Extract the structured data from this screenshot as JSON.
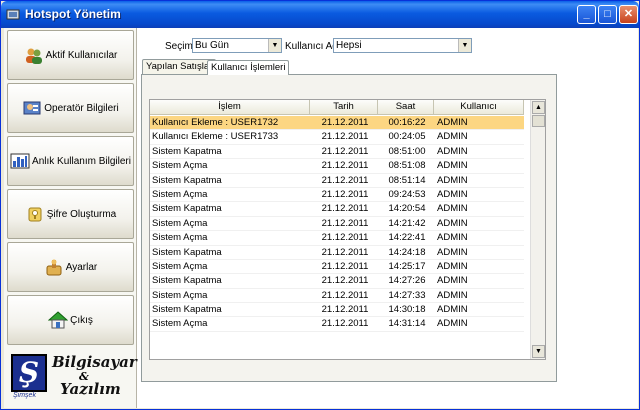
{
  "window": {
    "title": "Hotspot Yönetim"
  },
  "sidebar": {
    "items": [
      {
        "label": "Aktif Kullanıcılar",
        "icon": "users-icon"
      },
      {
        "label": "Operatör Bilgileri",
        "icon": "operator-icon"
      },
      {
        "label": "Anlık Kullanım Bilgileri",
        "icon": "bar-chart-icon"
      },
      {
        "label": "Şifre Oluşturma",
        "icon": "key-icon"
      },
      {
        "label": "Ayarlar",
        "icon": "settings-icon"
      },
      {
        "label": "Çıkış",
        "icon": "home-exit-icon"
      }
    ],
    "logo": {
      "line1": "Bilgisayar",
      "amp": "&",
      "line2": "Yazılım",
      "emblem": "Ş",
      "emblem_caption": "Şimşek"
    }
  },
  "filters": {
    "secim_label": "Seçim",
    "secim_value": "Bu Gün",
    "kullanici_label": "Kullanıcı Adı",
    "kullanici_value": "Hepsi"
  },
  "tabs": [
    {
      "label": "Yapılan Satışlar"
    },
    {
      "label": "Kullanıcı İşlemleri"
    }
  ],
  "grid": {
    "columns": [
      "İşlem",
      "Tarih",
      "Saat",
      "Kullanıcı"
    ],
    "rows": [
      [
        "Kullanıcı Ekleme : USER1732",
        "21.12.2011",
        "00:16:22",
        "ADMIN"
      ],
      [
        "Kullanıcı Ekleme : USER1733",
        "21.12.2011",
        "00:24:05",
        "ADMIN"
      ],
      [
        "Sistem Kapatma",
        "21.12.2011",
        "08:51:00",
        "ADMIN"
      ],
      [
        "Sistem Açma",
        "21.12.2011",
        "08:51:08",
        "ADMIN"
      ],
      [
        "Sistem Kapatma",
        "21.12.2011",
        "08:51:14",
        "ADMIN"
      ],
      [
        "Sistem Açma",
        "21.12.2011",
        "09:24:53",
        "ADMIN"
      ],
      [
        "Sistem Kapatma",
        "21.12.2011",
        "14:20:54",
        "ADMIN"
      ],
      [
        "Sistem Açma",
        "21.12.2011",
        "14:21:42",
        "ADMIN"
      ],
      [
        "Sistem Açma",
        "21.12.2011",
        "14:22:41",
        "ADMIN"
      ],
      [
        "Sistem Kapatma",
        "21.12.2011",
        "14:24:18",
        "ADMIN"
      ],
      [
        "Sistem Açma",
        "21.12.2011",
        "14:25:17",
        "ADMIN"
      ],
      [
        "Sistem Kapatma",
        "21.12.2011",
        "14:27:26",
        "ADMIN"
      ],
      [
        "Sistem Açma",
        "21.12.2011",
        "14:27:33",
        "ADMIN"
      ],
      [
        "Sistem Kapatma",
        "21.12.2011",
        "14:30:18",
        "ADMIN"
      ],
      [
        "Sistem Açma",
        "21.12.2011",
        "14:31:14",
        "ADMIN"
      ]
    ]
  },
  "colors": {
    "titlebar": "#0a5be0",
    "selected_row": "#fcd682"
  }
}
